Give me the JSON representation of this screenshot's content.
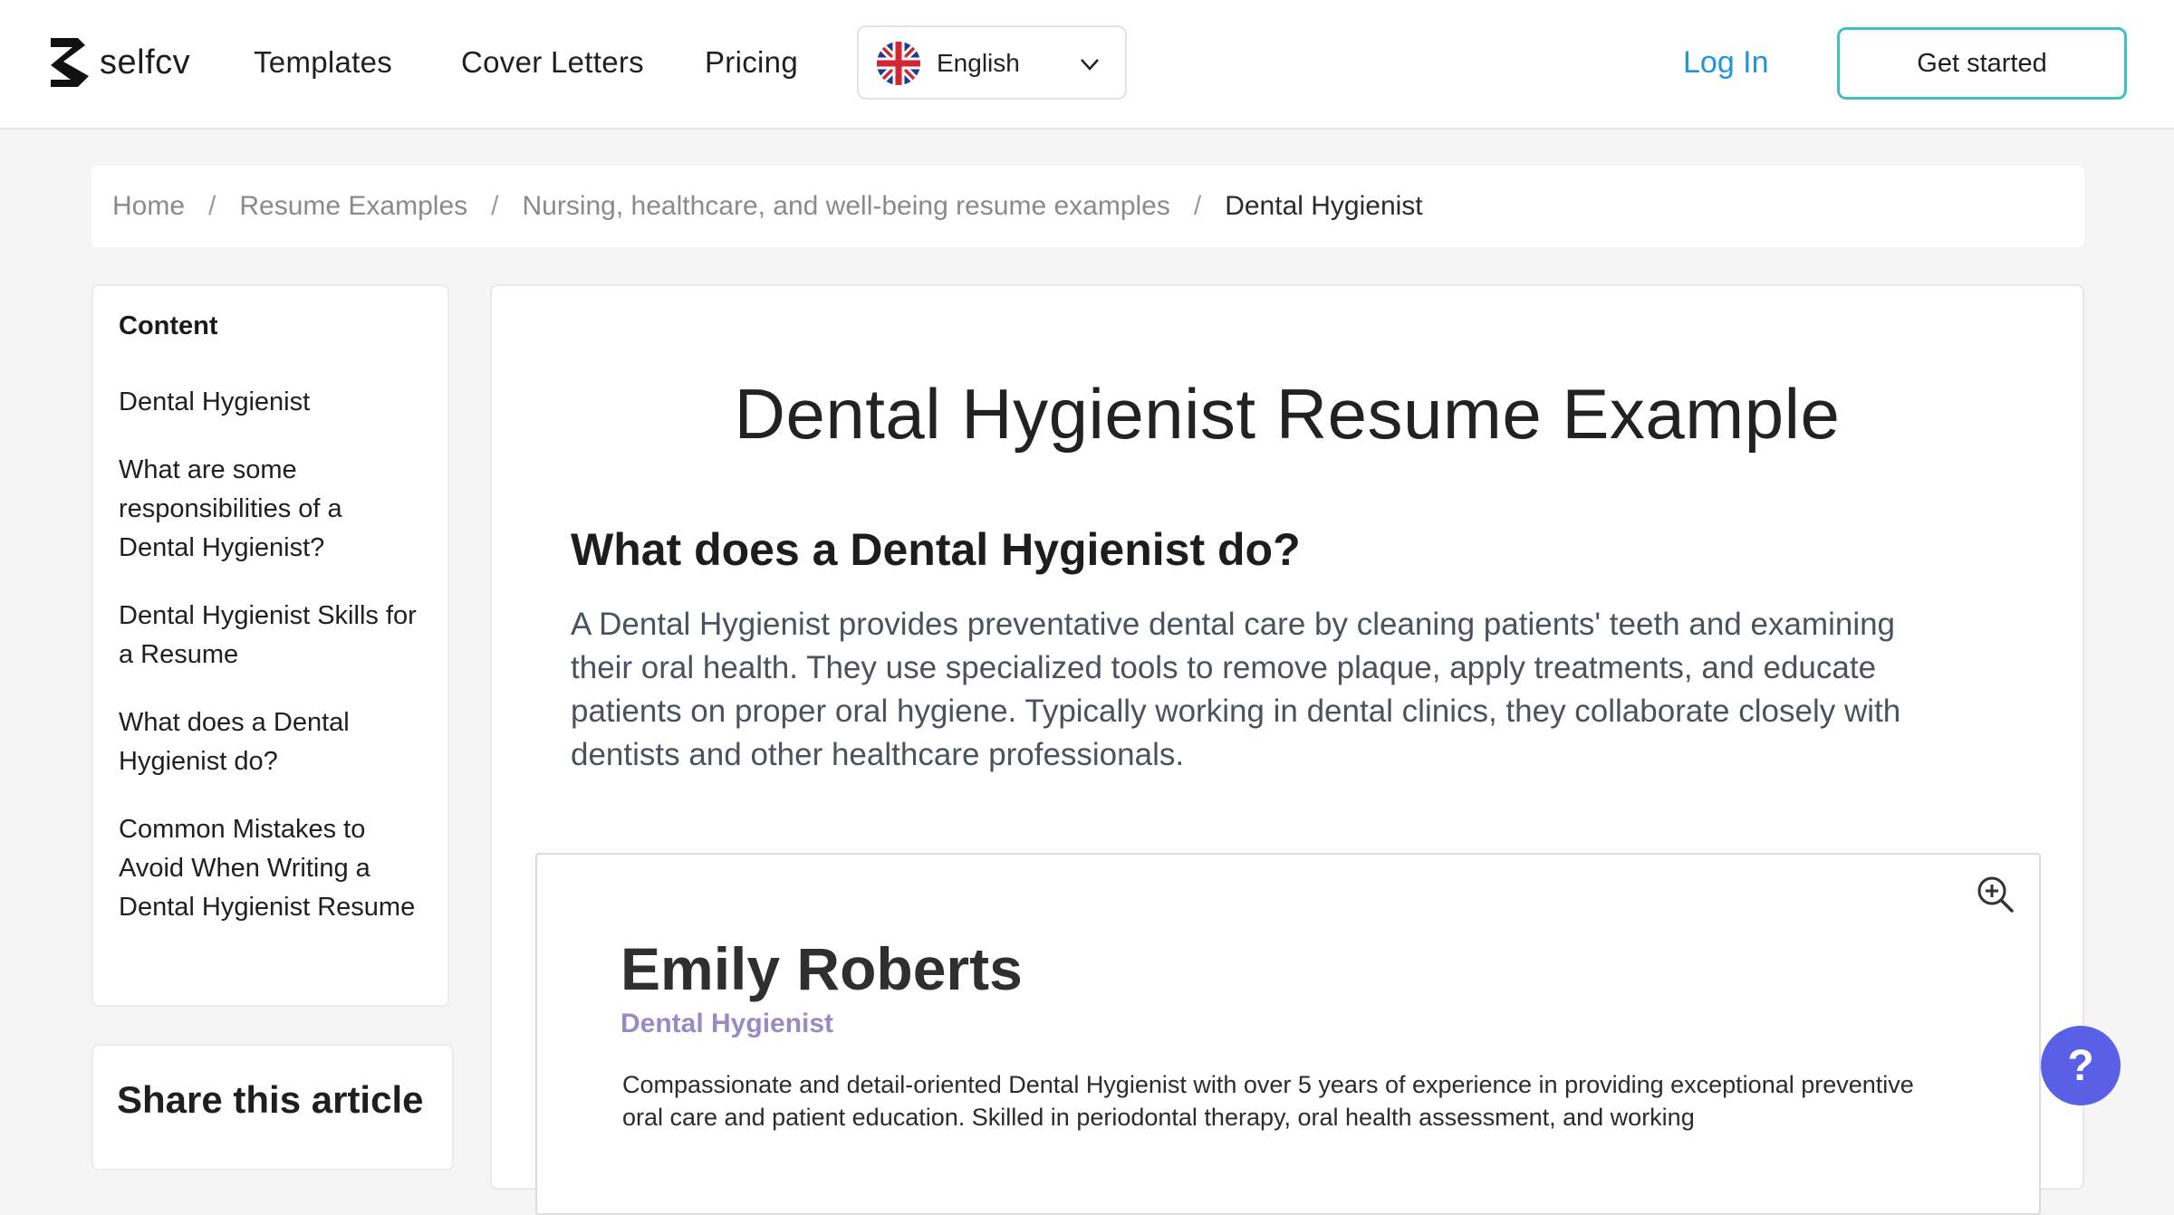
{
  "header": {
    "logo_text": "selfcv",
    "nav": [
      "Templates",
      "Cover Letters",
      "Pricing"
    ],
    "language": "English",
    "login": "Log In",
    "cta": "Get started"
  },
  "breadcrumb": [
    "Home",
    "Resume Examples",
    "Nursing, healthcare, and well-being resume examples",
    "Dental Hygienist"
  ],
  "toc": {
    "title": "Content",
    "items": [
      "Dental Hygienist",
      "What are some responsibilities of a Dental Hygienist?",
      "Dental Hygienist Skills for a Resume",
      "What does a Dental Hygienist do?",
      "Common Mistakes to Avoid When Writing a Dental Hygienist Resume"
    ]
  },
  "share": {
    "title": "Share this article"
  },
  "article": {
    "title": "Dental Hygienist Resume Example",
    "subtitle": "What does a Dental Hygienist do?",
    "paragraph": "A Dental Hygienist provides preventative dental care by cleaning patients' teeth and examining their oral health. They use specialized tools to remove plaque, apply treatments, and educate patients on proper oral hygiene. Typically working in dental clinics, they collaborate closely with dentists and other healthcare professionals."
  },
  "resume": {
    "name": "Emily Roberts",
    "role": "Dental Hygienist",
    "summary": "Compassionate and detail-oriented Dental Hygienist with over 5 years of experience in providing exceptional preventive oral care and patient education. Skilled in periodontal therapy, oral health assessment, and working"
  },
  "help": {
    "label": "?"
  },
  "colors": {
    "accent": "#2196d3",
    "cta_border": "#3ec1bf",
    "role_purple": "#9a8ac4",
    "help_bg": "#5a60e6"
  }
}
